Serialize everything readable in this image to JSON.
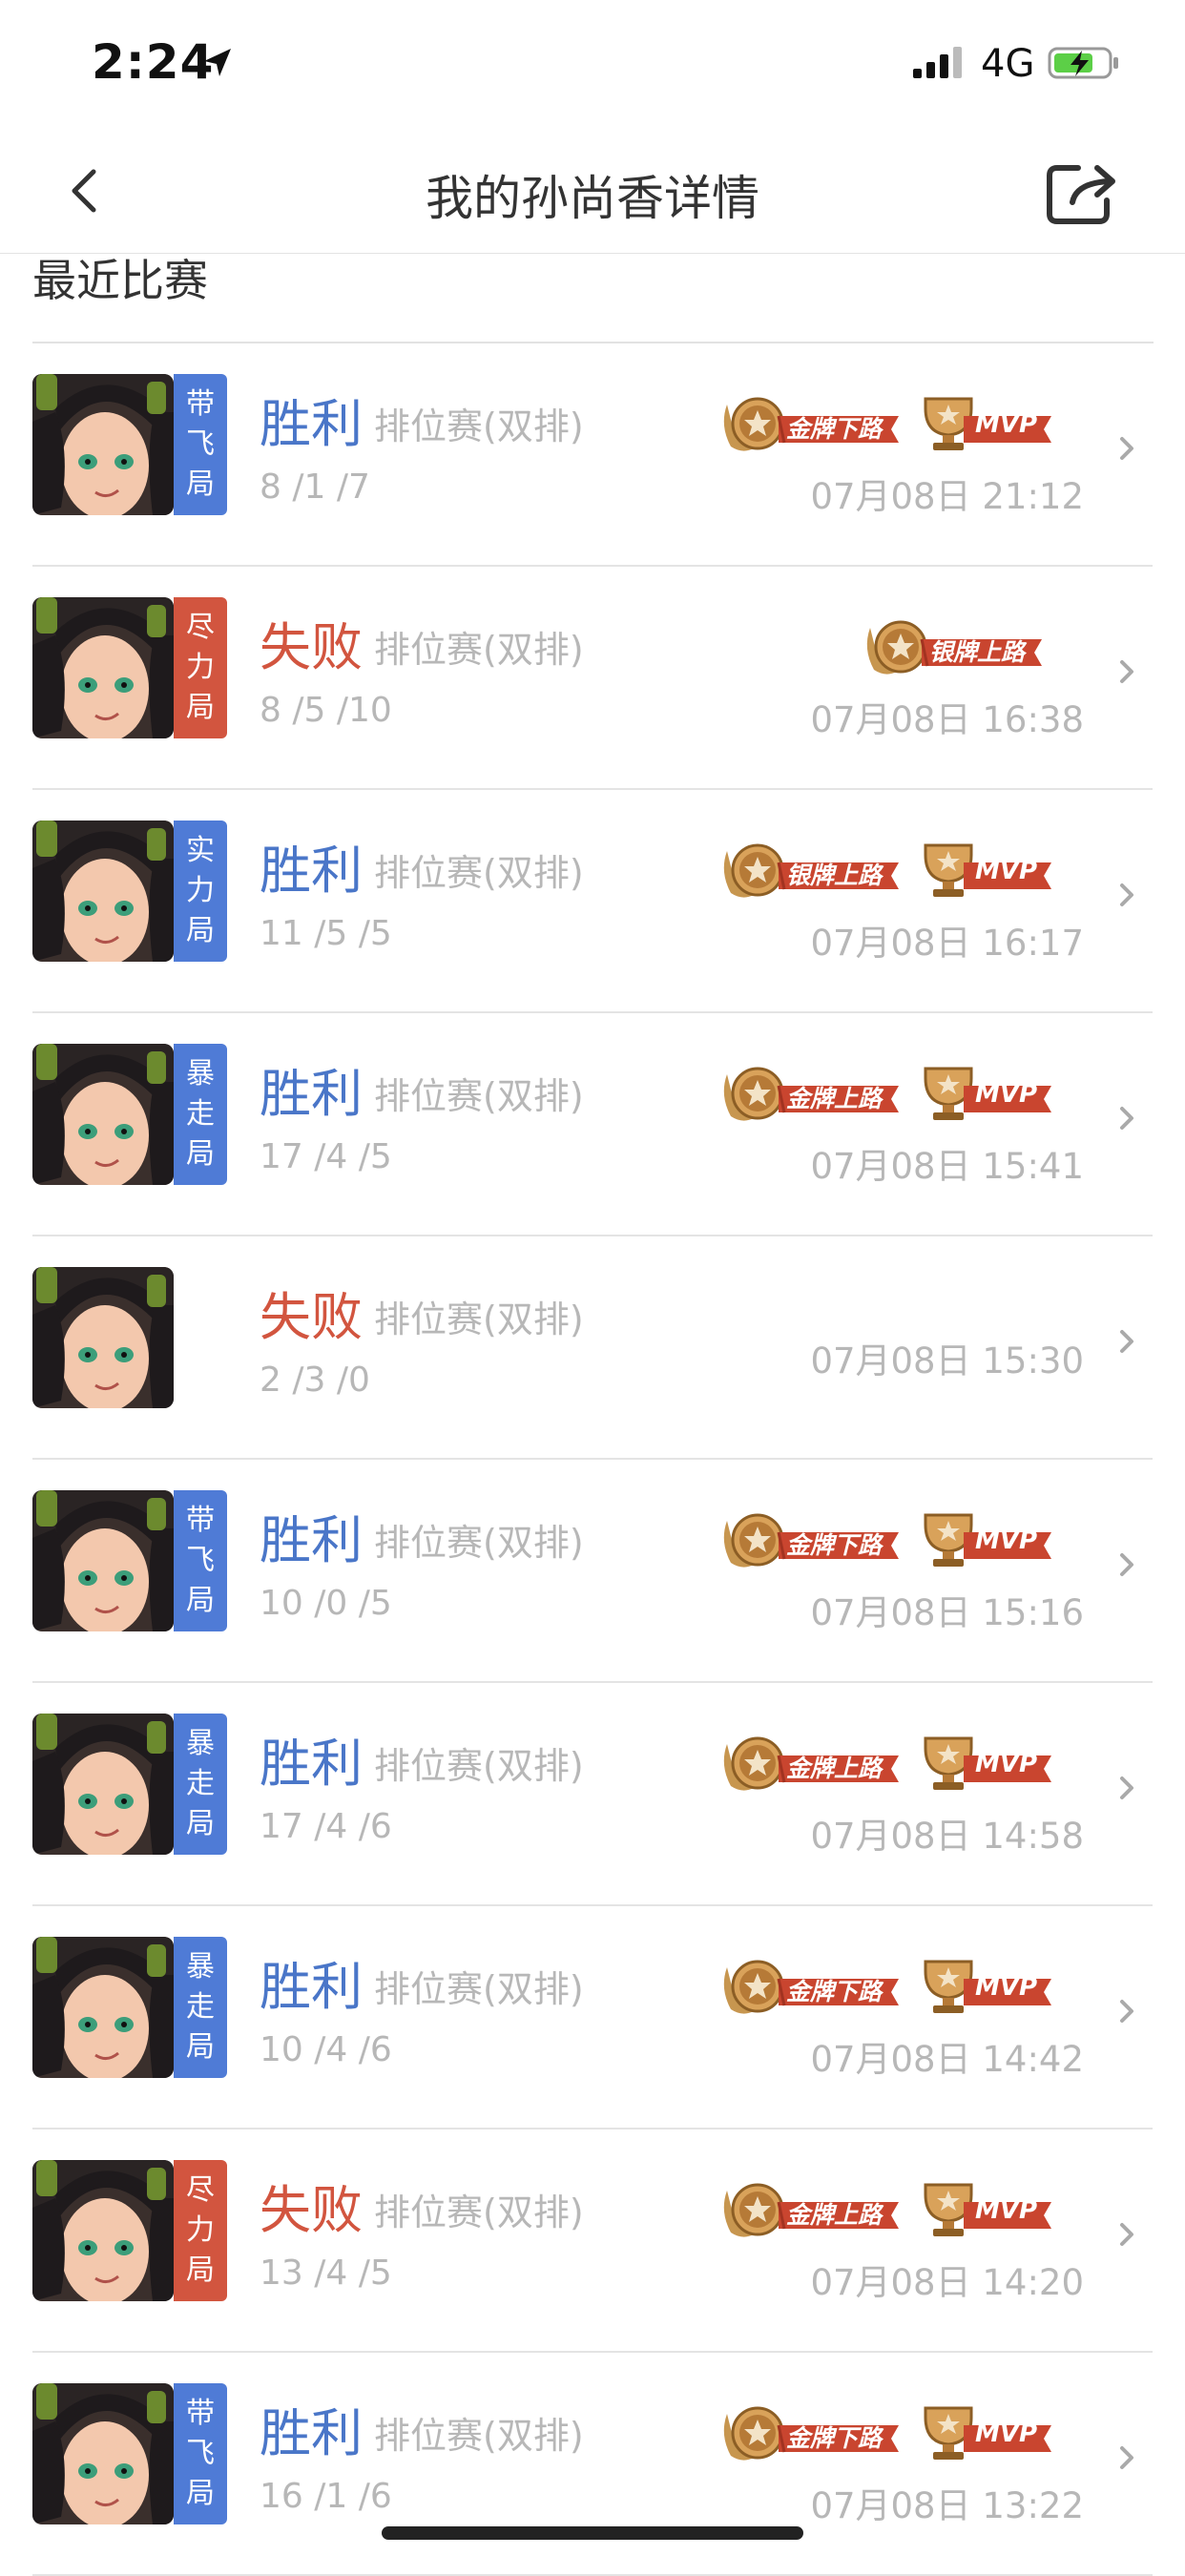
{
  "status_bar": {
    "time": "2:24",
    "network": "4G"
  },
  "header": {
    "title": "我的孙尚香详情"
  },
  "section": {
    "title": "最近比赛"
  },
  "colors": {
    "win": "#4a76c8",
    "lose": "#d2553f",
    "tag_blue": "#4f7bd6",
    "tag_red": "#d2553f",
    "badge_gold": "#c7964f",
    "badge_ribbon": "#c9452f"
  },
  "matches": [
    {
      "tag": [
        "带",
        "飞",
        "局"
      ],
      "tag_color": "blue",
      "result": "胜利",
      "result_type": "win",
      "mode": "排位赛(双排)",
      "kda": "8 /1 /7",
      "time": "07月08日 21:12",
      "title_badge": "金牌下路",
      "mvp": "MVP"
    },
    {
      "tag": [
        "尽",
        "力",
        "局"
      ],
      "tag_color": "red",
      "result": "失败",
      "result_type": "lose",
      "mode": "排位赛(双排)",
      "kda": "8 /5 /10",
      "time": "07月08日 16:38",
      "title_badge": "银牌上路",
      "mvp": ""
    },
    {
      "tag": [
        "实",
        "力",
        "局"
      ],
      "tag_color": "blue",
      "result": "胜利",
      "result_type": "win",
      "mode": "排位赛(双排)",
      "kda": "11 /5 /5",
      "time": "07月08日 16:17",
      "title_badge": "银牌上路",
      "mvp": "MVP"
    },
    {
      "tag": [
        "暴",
        "走",
        "局"
      ],
      "tag_color": "blue",
      "result": "胜利",
      "result_type": "win",
      "mode": "排位赛(双排)",
      "kda": "17 /4 /5",
      "time": "07月08日 15:41",
      "title_badge": "金牌上路",
      "mvp": "MVP"
    },
    {
      "tag": [],
      "tag_color": "",
      "result": "失败",
      "result_type": "lose",
      "mode": "排位赛(双排)",
      "kda": "2 /3 /0",
      "time": "07月08日 15:30",
      "title_badge": "",
      "mvp": ""
    },
    {
      "tag": [
        "带",
        "飞",
        "局"
      ],
      "tag_color": "blue",
      "result": "胜利",
      "result_type": "win",
      "mode": "排位赛(双排)",
      "kda": "10 /0 /5",
      "time": "07月08日 15:16",
      "title_badge": "金牌下路",
      "mvp": "MVP"
    },
    {
      "tag": [
        "暴",
        "走",
        "局"
      ],
      "tag_color": "blue",
      "result": "胜利",
      "result_type": "win",
      "mode": "排位赛(双排)",
      "kda": "17 /4 /6",
      "time": "07月08日 14:58",
      "title_badge": "金牌上路",
      "mvp": "MVP"
    },
    {
      "tag": [
        "暴",
        "走",
        "局"
      ],
      "tag_color": "blue",
      "result": "胜利",
      "result_type": "win",
      "mode": "排位赛(双排)",
      "kda": "10 /4 /6",
      "time": "07月08日 14:42",
      "title_badge": "金牌下路",
      "mvp": "MVP"
    },
    {
      "tag": [
        "尽",
        "力",
        "局"
      ],
      "tag_color": "red",
      "result": "失败",
      "result_type": "lose",
      "mode": "排位赛(双排)",
      "kda": "13 /4 /5",
      "time": "07月08日 14:20",
      "title_badge": "金牌上路",
      "mvp": "MVP"
    },
    {
      "tag": [
        "带",
        "飞",
        "局"
      ],
      "tag_color": "blue",
      "result": "胜利",
      "result_type": "win",
      "mode": "排位赛(双排)",
      "kda": "16 /1 /6",
      "time": "07月08日 13:22",
      "title_badge": "金牌下路",
      "mvp": "MVP"
    }
  ]
}
